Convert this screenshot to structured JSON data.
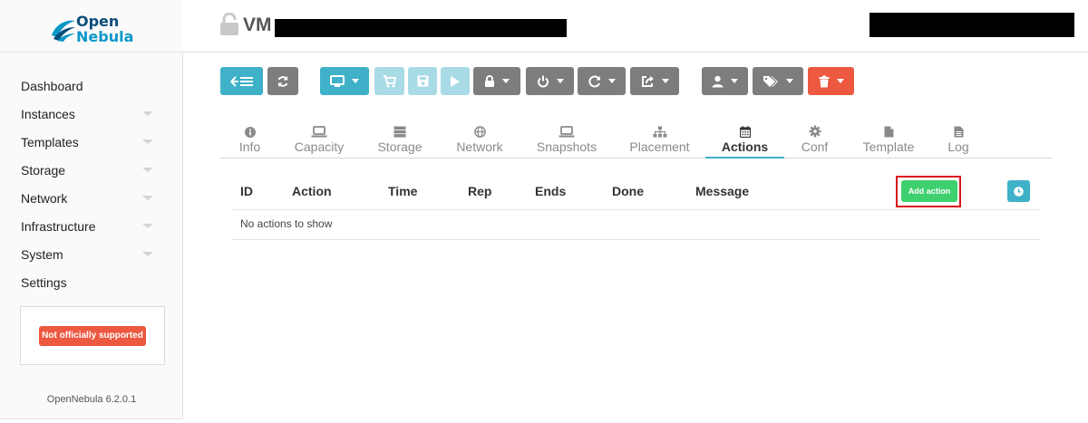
{
  "brand": {
    "line1": "Open",
    "line2": "Nebula"
  },
  "sidebar": {
    "items": [
      {
        "label": "Dashboard",
        "expandable": false
      },
      {
        "label": "Instances",
        "expandable": true
      },
      {
        "label": "Templates",
        "expandable": true
      },
      {
        "label": "Storage",
        "expandable": true
      },
      {
        "label": "Network",
        "expandable": true
      },
      {
        "label": "Infrastructure",
        "expandable": true
      },
      {
        "label": "System",
        "expandable": true
      },
      {
        "label": "Settings",
        "expandable": false
      }
    ],
    "support_badge": "Not officially supported",
    "version": "OpenNebula 6.2.0.1"
  },
  "header": {
    "title": "VM"
  },
  "toolbar": {
    "buttons": [
      {
        "icon": "back-to-list-icon"
      },
      {
        "icon": "refresh-icon"
      },
      {
        "icon": "monitor-icon"
      },
      {
        "icon": "cart-icon"
      },
      {
        "icon": "save-icon"
      },
      {
        "icon": "play-icon"
      },
      {
        "icon": "lock-icon"
      },
      {
        "icon": "power-icon"
      },
      {
        "icon": "reboot-icon"
      },
      {
        "icon": "share-icon"
      },
      {
        "icon": "user-icon"
      },
      {
        "icon": "tags-icon"
      },
      {
        "icon": "trash-icon"
      }
    ]
  },
  "tabs": [
    {
      "label": "Info",
      "icon": "info-icon"
    },
    {
      "label": "Capacity",
      "icon": "laptop-icon"
    },
    {
      "label": "Storage",
      "icon": "storage-icon"
    },
    {
      "label": "Network",
      "icon": "globe-icon"
    },
    {
      "label": "Snapshots",
      "icon": "laptop-icon"
    },
    {
      "label": "Placement",
      "icon": "sitemap-icon"
    },
    {
      "label": "Actions",
      "icon": "calendar-icon",
      "active": true
    },
    {
      "label": "Conf",
      "icon": "cog-icon"
    },
    {
      "label": "Template",
      "icon": "file-icon"
    },
    {
      "label": "Log",
      "icon": "file-text-icon"
    }
  ],
  "table": {
    "columns": [
      "ID",
      "Action",
      "Time",
      "Rep",
      "Ends",
      "Done",
      "Message"
    ],
    "add_action_label": "Add action",
    "empty_text": "No actions to show"
  },
  "colors": {
    "primary": "#3fb1c9",
    "secondary": "#7d7d7d",
    "alert": "#ec5840",
    "success": "#3ecf6e",
    "highlight_outline": "#d9141b"
  }
}
